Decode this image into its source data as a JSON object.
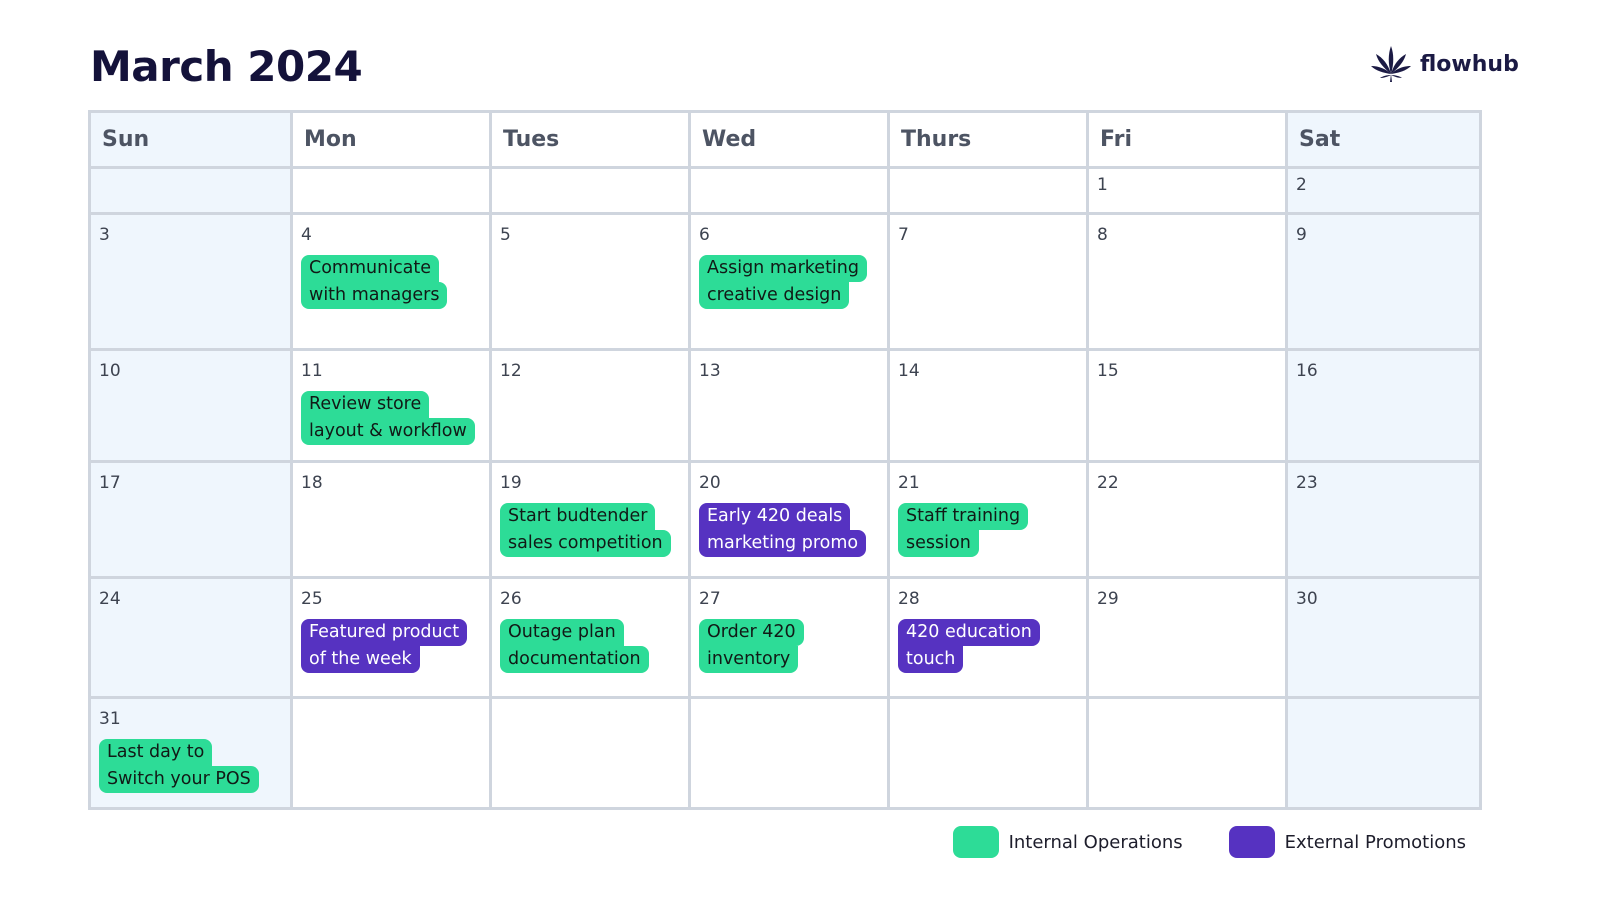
{
  "header": {
    "title": "March 2024",
    "brand_name": "flowhub",
    "brand_icon": "cannabis-leaf-icon"
  },
  "colors": {
    "internal": "#2ddc97",
    "external": "#5632c1",
    "weekend_bg": "#eff6fd",
    "grid_line": "#cfd5de"
  },
  "calendar": {
    "weekdays": [
      "Sun",
      "Mon",
      "Tues",
      "Wed",
      "Thurs",
      "Fri",
      "Sat"
    ],
    "weeks": [
      [
        {
          "day": ""
        },
        {
          "day": ""
        },
        {
          "day": ""
        },
        {
          "day": ""
        },
        {
          "day": ""
        },
        {
          "day": "1"
        },
        {
          "day": "2"
        }
      ],
      [
        {
          "day": "3"
        },
        {
          "day": "4",
          "event": {
            "type": "internal",
            "line1": "Communicate",
            "line2": "with managers"
          }
        },
        {
          "day": "5"
        },
        {
          "day": "6",
          "event": {
            "type": "internal",
            "line1": "Assign marketing",
            "line2": "creative design"
          }
        },
        {
          "day": "7"
        },
        {
          "day": "8"
        },
        {
          "day": "9"
        }
      ],
      [
        {
          "day": "10"
        },
        {
          "day": "11",
          "event": {
            "type": "internal",
            "line1": "Review store",
            "line2": "layout & workflow"
          }
        },
        {
          "day": "12"
        },
        {
          "day": "13"
        },
        {
          "day": "14"
        },
        {
          "day": "15"
        },
        {
          "day": "16"
        }
      ],
      [
        {
          "day": "17"
        },
        {
          "day": "18"
        },
        {
          "day": "19",
          "event": {
            "type": "internal",
            "line1": "Start budtender",
            "line2": "sales competition"
          }
        },
        {
          "day": "20",
          "event": {
            "type": "external",
            "line1": "Early 420 deals",
            "line2": "marketing promo"
          }
        },
        {
          "day": "21",
          "event": {
            "type": "internal",
            "line1": "Staff training",
            "line2": "session"
          }
        },
        {
          "day": "22"
        },
        {
          "day": "23"
        }
      ],
      [
        {
          "day": "24"
        },
        {
          "day": "25",
          "event": {
            "type": "external",
            "line1": "Featured product",
            "line2": "of the week"
          }
        },
        {
          "day": "26",
          "event": {
            "type": "internal",
            "line1": "Outage plan",
            "line2": "documentation"
          }
        },
        {
          "day": "27",
          "event": {
            "type": "internal",
            "line1": "Order 420",
            "line2": "inventory"
          }
        },
        {
          "day": "28",
          "event": {
            "type": "external",
            "line1": "420 education",
            "line2": "touch"
          }
        },
        {
          "day": "29"
        },
        {
          "day": "30"
        }
      ],
      [
        {
          "day": "31",
          "event": {
            "type": "internal",
            "line1": "Last day to",
            "line2": "Switch your POS"
          }
        },
        {
          "day": ""
        },
        {
          "day": ""
        },
        {
          "day": ""
        },
        {
          "day": ""
        },
        {
          "day": ""
        },
        {
          "day": ""
        }
      ]
    ]
  },
  "legend": [
    {
      "key": "internal",
      "label": "Internal Operations"
    },
    {
      "key": "external",
      "label": "External Promotions"
    }
  ]
}
